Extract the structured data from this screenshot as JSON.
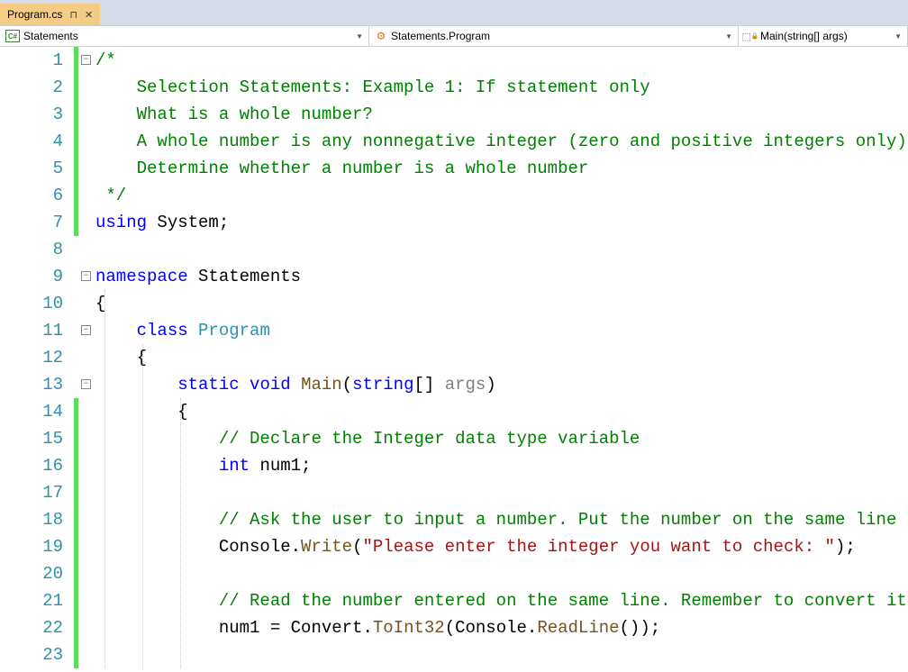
{
  "tab": {
    "filename": "Program.cs",
    "pinned": true
  },
  "navbar": {
    "scope": "Statements",
    "class": "Statements.Program",
    "method": "Main(string[] args)"
  },
  "code": {
    "lines": [
      {
        "n": 1,
        "fold": true,
        "green": [
          0,
          6
        ],
        "segs": [
          [
            "c-comment",
            "/*"
          ]
        ]
      },
      {
        "n": 2,
        "green": [
          0,
          6
        ],
        "segs": [
          [
            "c-comment",
            "    Selection Statements: Example 1: If statement only"
          ]
        ]
      },
      {
        "n": 3,
        "green": [
          0,
          6
        ],
        "segs": [
          [
            "c-comment",
            "    What is a whole number?"
          ]
        ]
      },
      {
        "n": 4,
        "green": [
          0,
          6
        ],
        "segs": [
          [
            "c-comment",
            "    A whole number is any nonnegative integer (zero and positive integers only)"
          ]
        ]
      },
      {
        "n": 5,
        "green": [
          0,
          6
        ],
        "segs": [
          [
            "c-comment",
            "    Determine whether a number is a whole number"
          ]
        ]
      },
      {
        "n": 6,
        "green": [
          0,
          6
        ],
        "segs": [
          [
            "c-comment",
            " */"
          ]
        ]
      },
      {
        "n": 7,
        "green": [
          0,
          6
        ],
        "segs": [
          [
            "c-keyword",
            "using"
          ],
          [
            "c-text",
            " System;"
          ]
        ]
      },
      {
        "n": 8,
        "segs": []
      },
      {
        "n": 9,
        "fold": true,
        "segs": [
          [
            "c-keyword",
            "namespace"
          ],
          [
            "c-text",
            " Statements"
          ]
        ]
      },
      {
        "n": 10,
        "segs": [
          [
            "c-text",
            "{"
          ]
        ]
      },
      {
        "n": 11,
        "fold": true,
        "indent": 1,
        "segs": [
          [
            "c-text",
            "    "
          ],
          [
            "c-keyword",
            "class"
          ],
          [
            "c-text",
            " "
          ],
          [
            "c-type",
            "Program"
          ]
        ]
      },
      {
        "n": 12,
        "indent": 1,
        "segs": [
          [
            "c-text",
            "    {"
          ]
        ]
      },
      {
        "n": 13,
        "fold": true,
        "indent": 2,
        "segs": [
          [
            "c-text",
            "        "
          ],
          [
            "c-keyword",
            "static"
          ],
          [
            "c-text",
            " "
          ],
          [
            "c-keyword",
            "void"
          ],
          [
            "c-text",
            " "
          ],
          [
            "c-method",
            "Main"
          ],
          [
            "c-text",
            "("
          ],
          [
            "c-keyword",
            "string"
          ],
          [
            "c-text",
            "[] "
          ],
          [
            "c-param",
            "args"
          ],
          [
            "c-text",
            ")"
          ]
        ]
      },
      {
        "n": 14,
        "green": [
          0,
          23
        ],
        "indent": 2,
        "segs": [
          [
            "c-text",
            "        {"
          ]
        ]
      },
      {
        "n": 15,
        "green": [
          0,
          23
        ],
        "indent": 3,
        "segs": [
          [
            "c-text",
            "            "
          ],
          [
            "c-comment",
            "// Declare the Integer data type variable"
          ]
        ]
      },
      {
        "n": 16,
        "green": [
          0,
          23
        ],
        "indent": 3,
        "segs": [
          [
            "c-text",
            "            "
          ],
          [
            "c-keyword",
            "int"
          ],
          [
            "c-text",
            " num1;"
          ]
        ]
      },
      {
        "n": 17,
        "green": [
          0,
          23
        ],
        "indent": 3,
        "segs": []
      },
      {
        "n": 18,
        "green": [
          0,
          23
        ],
        "indent": 3,
        "segs": [
          [
            "c-text",
            "            "
          ],
          [
            "c-comment",
            "// Ask the user to input a number. Put the number on the same line"
          ]
        ]
      },
      {
        "n": 19,
        "green": [
          0,
          23
        ],
        "indent": 3,
        "segs": [
          [
            "c-text",
            "            Console."
          ],
          [
            "c-method",
            "Write"
          ],
          [
            "c-text",
            "("
          ],
          [
            "c-string",
            "\"Please enter the integer you want to check: \""
          ],
          [
            "c-text",
            ");"
          ]
        ]
      },
      {
        "n": 20,
        "green": [
          0,
          23
        ],
        "indent": 3,
        "segs": []
      },
      {
        "n": 21,
        "green": [
          0,
          23
        ],
        "indent": 3,
        "segs": [
          [
            "c-text",
            "            "
          ],
          [
            "c-comment",
            "// Read the number entered on the same line. Remember to convert it to an integer"
          ]
        ]
      },
      {
        "n": 22,
        "green": [
          0,
          23
        ],
        "indent": 3,
        "segs": [
          [
            "c-text",
            "            num1 = Convert."
          ],
          [
            "c-method",
            "ToInt32"
          ],
          [
            "c-text",
            "(Console."
          ],
          [
            "c-method",
            "ReadLine"
          ],
          [
            "c-text",
            "());"
          ]
        ]
      },
      {
        "n": 23,
        "green": [
          0,
          23
        ],
        "indent": 3,
        "segs": []
      }
    ]
  }
}
